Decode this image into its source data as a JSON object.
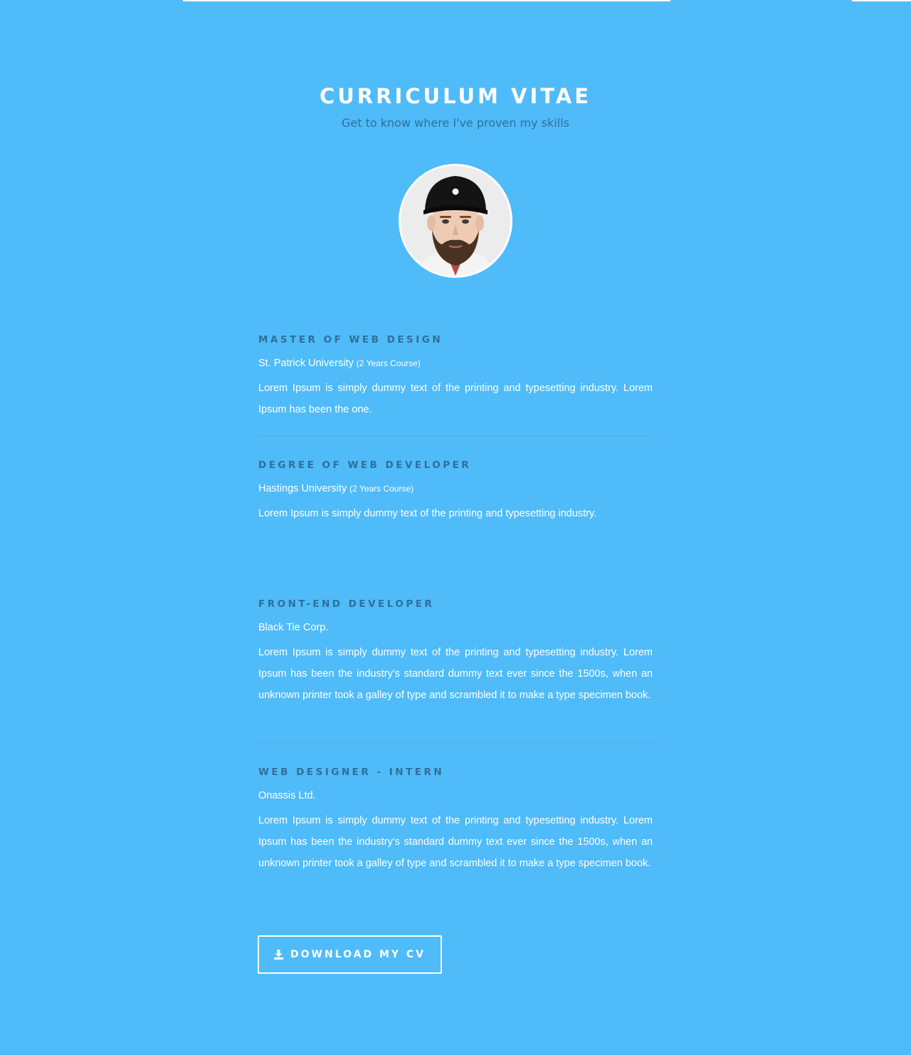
{
  "header": {
    "title": "CURRICULUM VITAE",
    "subtitle": "Get to know where I've proven my skills"
  },
  "profile": {
    "avatar_icon": "profile-photo"
  },
  "education": [
    {
      "title": "MASTER OF WEB DESIGN",
      "institution": "St. Patrick University",
      "course": "(2 Years Course)",
      "description": "Lorem Ipsum is simply dummy text of the printing and typesetting industry. Lorem Ipsum has been the one."
    },
    {
      "title": "DEGREE OF WEB DEVELOPER",
      "institution": "Hastings University",
      "course": "(2 Years Course)",
      "description": "Lorem Ipsum is simply dummy text of the printing and typesetting industry."
    }
  ],
  "experience": [
    {
      "title": "FRONT-END DEVELOPER",
      "company": "Black Tie Corp.",
      "description": "Lorem Ipsum is simply dummy text of the printing and typesetting industry. Lorem Ipsum has been the industry's standard dummy text ever since the 1500s, when an unknown printer took a galley of type and scrambled it to make a type specimen book."
    },
    {
      "title": "WEB DESIGNER - INTERN",
      "company": "Onassis Ltd.",
      "description": "Lorem Ipsum is simply dummy text of the printing and typesetting industry. Lorem Ipsum has been the industry's standard dummy text ever since the 1500s, when an unknown printer took a galley of type and scrambled it to make a type specimen book."
    }
  ],
  "actions": {
    "download_label": "DOWNLOAD MY CV",
    "download_icon": "download-icon"
  },
  "colors": {
    "background": "#4fbbf9",
    "heading_dark": "#2f6f99",
    "text": "#ffffff"
  }
}
